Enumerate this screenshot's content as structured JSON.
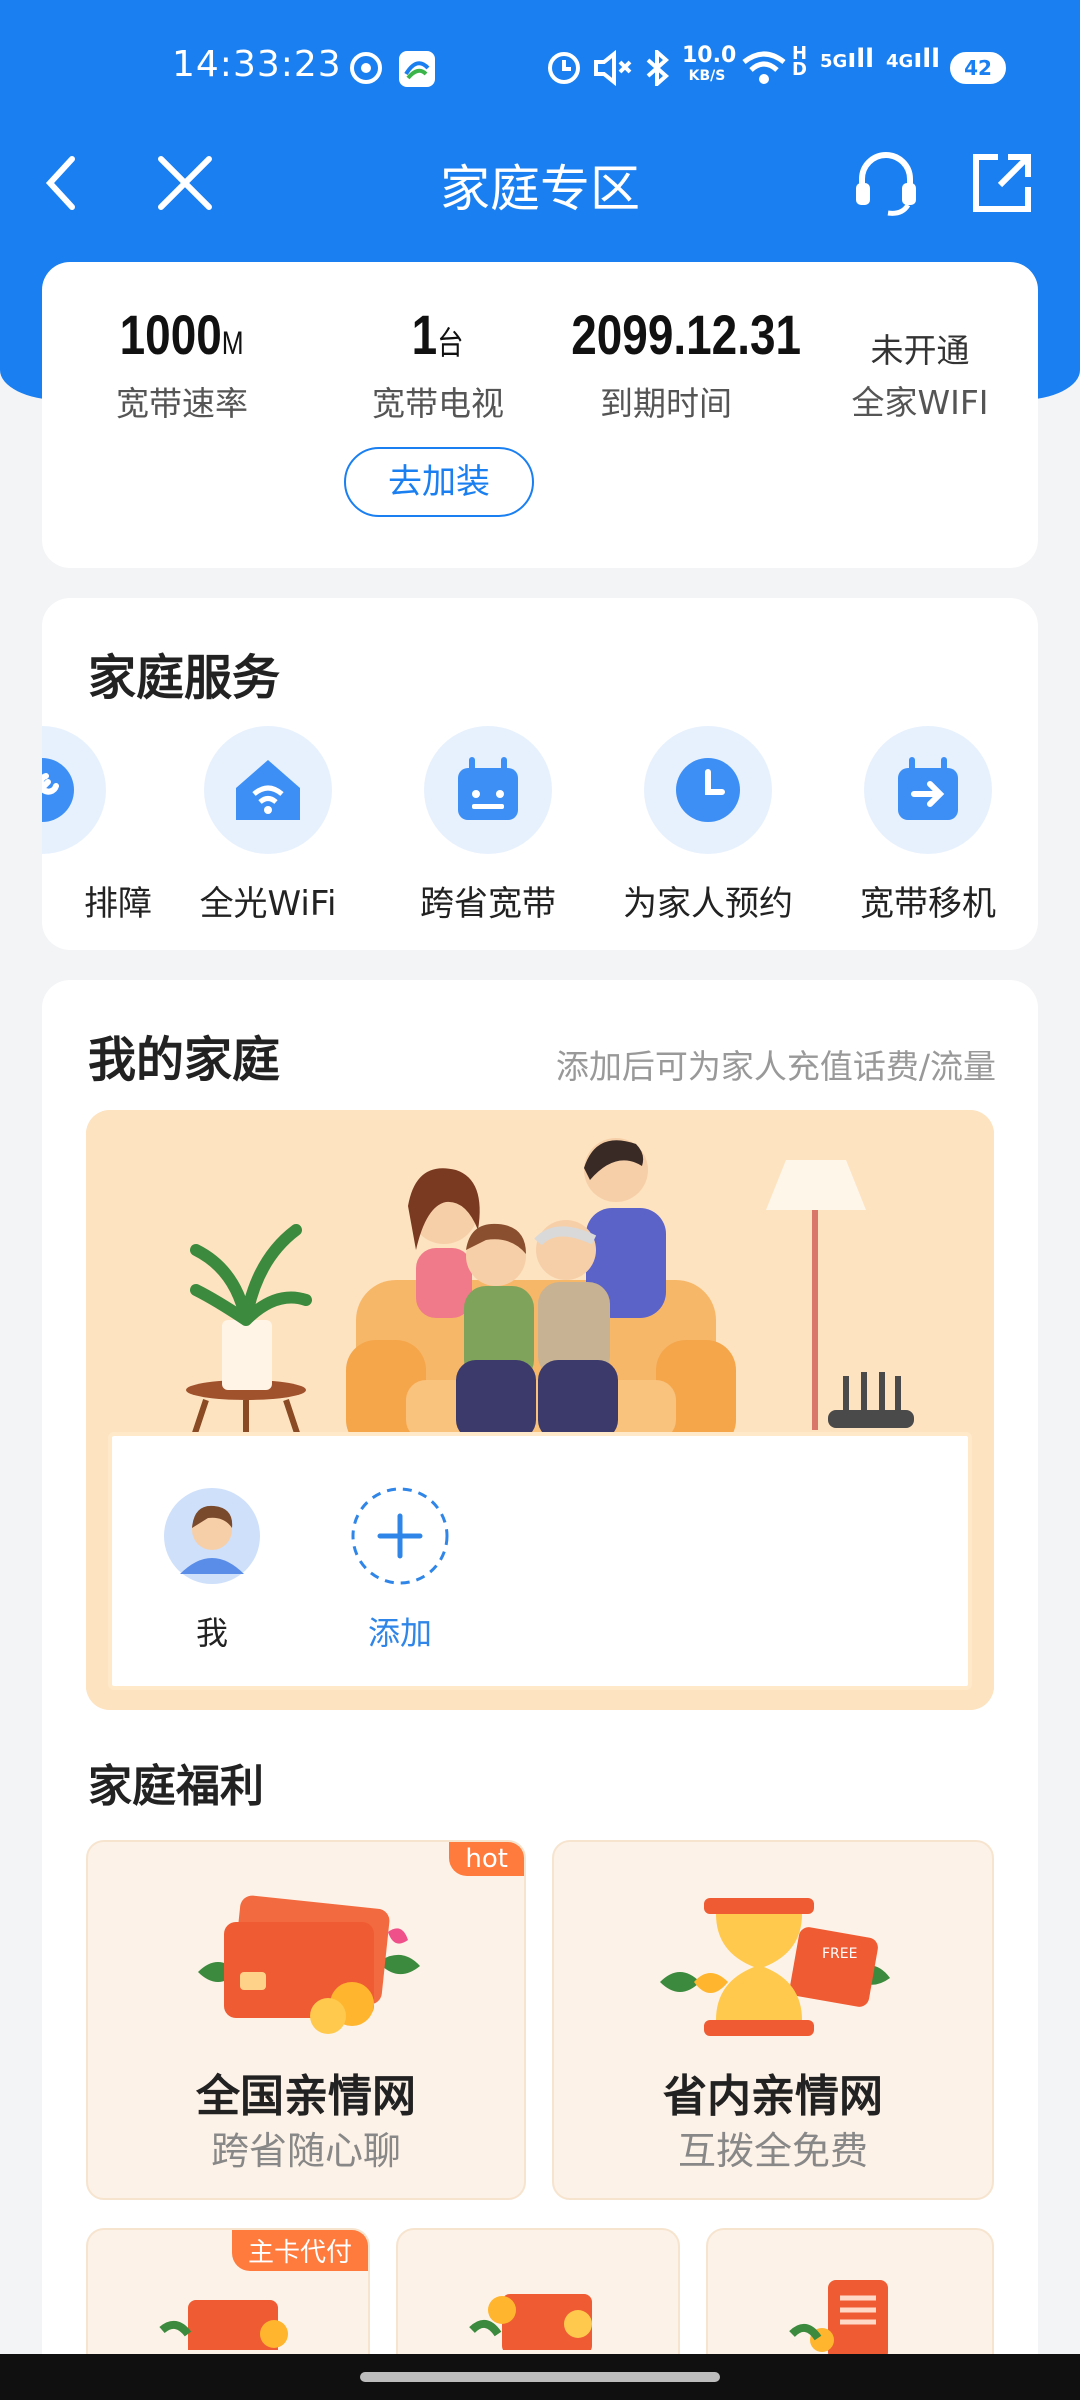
{
  "status_bar": {
    "time": "14:33:23",
    "net_speed_value": "10.0",
    "net_speed_unit": "KB/S",
    "sig1": "5G",
    "sig2": "4G",
    "battery": "42"
  },
  "nav": {
    "title": "家庭专区",
    "icons": [
      "back-icon",
      "close-icon",
      "headset-icon",
      "share-icon"
    ]
  },
  "summary": {
    "items": [
      {
        "value": "1000",
        "unit": "M",
        "label": "宽带速率"
      },
      {
        "value": "1",
        "unit": "台",
        "label": "宽带电视"
      },
      {
        "value": "2099.12.31",
        "unit": "",
        "label": "到期时间"
      },
      {
        "value": "未开通",
        "unit": "",
        "label": "全家WIFI"
      }
    ],
    "add_button": "去加装"
  },
  "services": {
    "title": "家庭服务",
    "items": [
      {
        "label": "排障",
        "icon": "wrench-icon"
      },
      {
        "label": "全光WiFi",
        "icon": "home-wifi-icon"
      },
      {
        "label": "跨省宽带",
        "icon": "router-icon"
      },
      {
        "label": "为家人预约",
        "icon": "clock-icon"
      },
      {
        "label": "宽带移机",
        "icon": "move-icon"
      }
    ]
  },
  "family": {
    "title": "我的家庭",
    "hint": "添加后可为家人充值话费/流量",
    "members": [
      {
        "label": "我"
      }
    ],
    "add_label": "添加"
  },
  "welfare": {
    "title": "家庭福利",
    "cards": [
      {
        "title": "全国亲情网",
        "subtitle": "跨省随心聊",
        "tag": "hot",
        "icon": "cards-icon"
      },
      {
        "title": "省内亲情网",
        "subtitle": "互拨全免费",
        "tag": "",
        "icon": "hourglass-icon",
        "badge": "FREE"
      }
    ],
    "small_cards": [
      {
        "tag": "主卡代付"
      },
      {
        "tag": ""
      },
      {
        "tag": ""
      }
    ]
  },
  "colors": {
    "brand": "#1a7ff0",
    "accent": "#ff7a3d",
    "banner": "#fde0b9"
  }
}
